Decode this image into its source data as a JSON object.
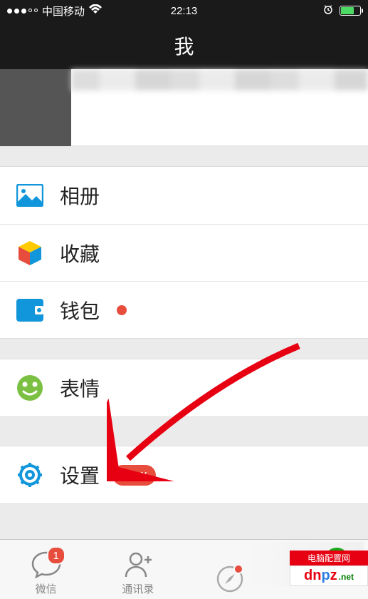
{
  "status": {
    "carrier": "中国移动",
    "time": "22:13"
  },
  "header": {
    "title": "我"
  },
  "menu": {
    "album": "相册",
    "favorites": "收藏",
    "wallet": "钱包",
    "stickers": "表情",
    "settings": "设置",
    "settings_badge": "new"
  },
  "tabs": {
    "chats": {
      "label": "微信",
      "badge": "1"
    },
    "contacts": {
      "label": "通讯录"
    },
    "discover": {
      "label": ""
    },
    "me": {
      "label": ""
    }
  },
  "watermark": {
    "top": "电脑配置网",
    "dn": "dn",
    "p": "p",
    "z": "z",
    "net": ".net"
  }
}
